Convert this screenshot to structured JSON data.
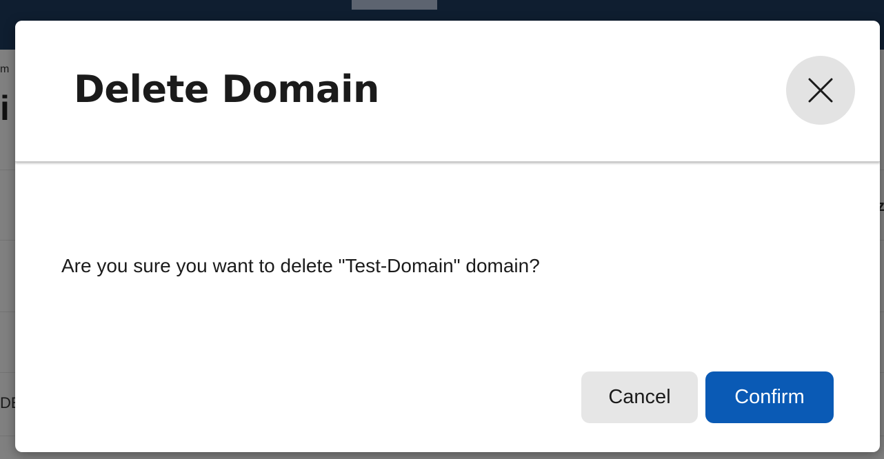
{
  "background": {
    "breadcrumb_fragment": "m",
    "heading_fragment": "i",
    "table_cell_fragment": "DE",
    "right_edge_fragment": "z"
  },
  "modal": {
    "title": "Delete Domain",
    "close_icon": "close-icon",
    "message": "Are you sure you want to delete \"Test-Domain\" domain?",
    "cancel_label": "Cancel",
    "confirm_label": "Confirm"
  },
  "colors": {
    "confirm_button": "#0a5ab5",
    "cancel_button": "#e6e6e6",
    "close_button": "#e3e3e3",
    "overlay": "#7f7f7f",
    "topbar": "#0f1e30"
  }
}
